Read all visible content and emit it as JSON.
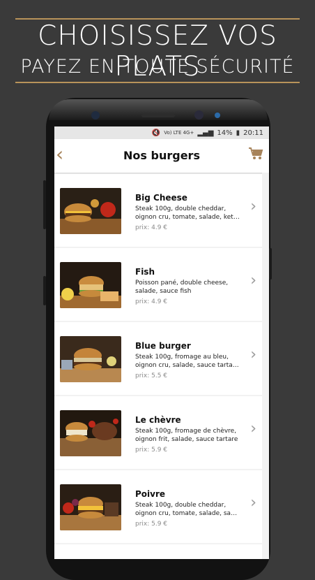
{
  "hero": {
    "line1": "CHOISISSEZ VOS PLATS",
    "line2": "PAYEZ EN TOUTE SÉCURITÉ",
    "accent": "#b8935a"
  },
  "status": {
    "network": "Vo) LTE 4G+",
    "battery": "14%",
    "time": "20:11"
  },
  "appbar": {
    "title": "Nos burgers",
    "back_icon": "chevron-left-icon",
    "cart_icon": "cart-icon",
    "accent": "#a7835a"
  },
  "items": [
    {
      "name": "Big Cheese",
      "desc": "Steak 100g, double cheddar, oignon cru, tomate, salade, ket…",
      "price": "prix: 4.9 €"
    },
    {
      "name": "Fish",
      "desc": "Poisson pané, double cheese, salade, sauce fish",
      "price": "prix: 4.9 €"
    },
    {
      "name": "Blue burger",
      "desc": "Steak 100g, fromage au bleu, oignon cru, salade, sauce tarta…",
      "price": "prix: 5.5 €"
    },
    {
      "name": "Le chèvre",
      "desc": "Steak 100g, fromage de chèvre, oignon frit, salade, sauce tartare",
      "price": "prix: 5.9 €"
    },
    {
      "name": "Poivre",
      "desc": "Steak 100g, double cheddar, oignon cru, tomate, salade, sa…",
      "price": "prix: 5.9 €"
    }
  ]
}
